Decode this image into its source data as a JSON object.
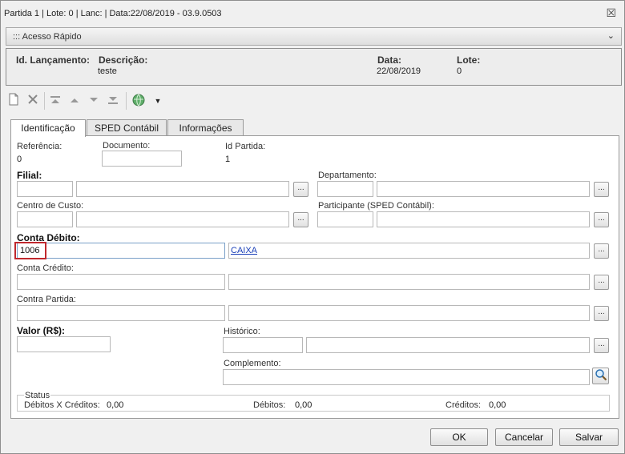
{
  "window": {
    "title": "Partida 1 | Lote: 0 | Lanc:  | Data:22/08/2019 - 03.9.0503",
    "close_symbol": "☒"
  },
  "quick_access": {
    "label": "::: Acesso Rápido",
    "chevron": "⌄"
  },
  "header": {
    "id_label": "Id. Lançamento:",
    "desc_label": "Descrição:",
    "desc_value": "teste",
    "date_label": "Data:",
    "date_value": "22/08/2019",
    "lote_label": "Lote:",
    "lote_value": "0"
  },
  "tabs": [
    {
      "label": "Identificação"
    },
    {
      "label": "SPED Contábil"
    },
    {
      "label": "Informações"
    }
  ],
  "form": {
    "referencia_label": "Referência:",
    "referencia_value": "0",
    "documento_label": "Documento:",
    "documento_value": "",
    "id_partida_label": "Id Partida:",
    "id_partida_value": "1",
    "filial_label": "Filial:",
    "departamento_label": "Departamento:",
    "centro_custo_label": "Centro de Custo:",
    "participante_label": "Participante (SPED Contábil):",
    "conta_debito_label": "Conta Débito:",
    "conta_debito_code": "1006",
    "conta_debito_name": "CAIXA",
    "conta_credito_label": "Conta Crédito:",
    "contra_partida_label": "Contra Partida:",
    "valor_label": "Valor (R$):",
    "historico_label": "Histórico:",
    "complemento_label": "Complemento:",
    "lookup_label": "...",
    "magnifier_icon": "search-icon"
  },
  "status": {
    "title": "Status",
    "debitos_x_creditos_label": "Débitos X Créditos:",
    "debitos_x_creditos_value": "0,00",
    "debitos_label": "Débitos:",
    "debitos_value": "0,00",
    "creditos_label": "Créditos:",
    "creditos_value": "0,00"
  },
  "buttons": {
    "ok": "OK",
    "cancel": "Cancelar",
    "save": "Salvar"
  }
}
